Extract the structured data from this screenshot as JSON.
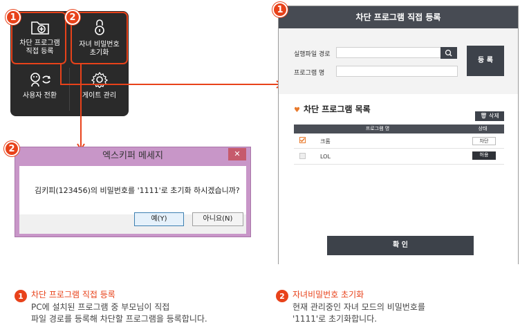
{
  "menu": {
    "buttons": [
      {
        "label": "차단 프로그램\n직접 등록",
        "icon": "folder-plus-icon"
      },
      {
        "label": "자녀 비밀번호\n초기화",
        "icon": "lock-icon"
      },
      {
        "label": "사용자 전환",
        "icon": "user-switch-icon"
      },
      {
        "label": "게이트 관리",
        "icon": "gear-icon"
      }
    ],
    "badges": [
      "1",
      "2"
    ]
  },
  "dialog": {
    "badge": "2",
    "title": "엑스키퍼 메세지",
    "close": "✕",
    "message": "김키피(123456)의 비밀번호를 '1111'로 초기화 하시겠습니까?",
    "yes_label": "예(Y)",
    "no_label": "아니요(N)"
  },
  "register_window": {
    "badge": "1",
    "title": "차단 프로그램 직접 등록",
    "exe_path_label": "실행파일 경로",
    "program_name_label": "프로그램 명",
    "register_label": "등 록",
    "list_title": "차단 프로그램 목록",
    "delete_label": "삭제",
    "columns": [
      "프로그램 명",
      "상태"
    ],
    "rows": [
      {
        "name": "크롬",
        "checked": true,
        "state": "차단"
      },
      {
        "name": "LOL",
        "checked": false,
        "state": "허용"
      }
    ],
    "confirm_label": "확 인"
  },
  "captions": [
    {
      "num": "1",
      "title": "차단 프로그램 직접 등록",
      "body": "PC에 설치된 프로그램 중 부모님이 직접\n파일 경로를 등록해 차단할 프로그램을 등록합니다."
    },
    {
      "num": "2",
      "title": "자녀비밀번호 초기화",
      "body": "현재 관리중인 자녀 모드의 비밀번호를\n'1111'로 초기화합니다."
    }
  ],
  "colors": {
    "accent": "#e8421a",
    "dark": "#3d424a",
    "dialog_frame": "#c896c8"
  }
}
